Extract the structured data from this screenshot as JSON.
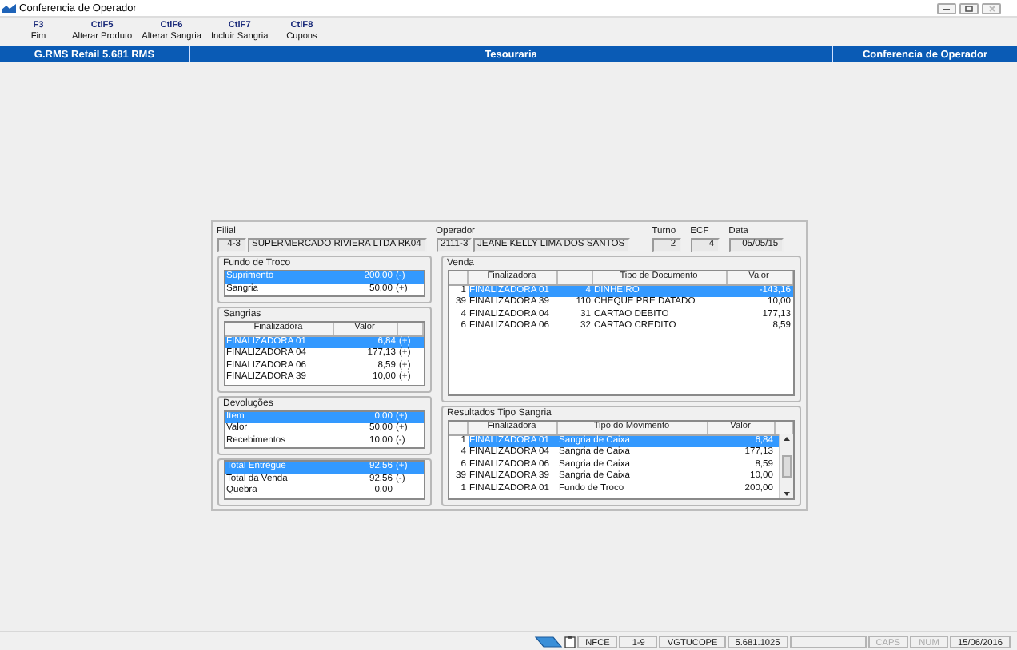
{
  "window": {
    "title": "Conferencia de Operador"
  },
  "toolbar": [
    {
      "key": "F3",
      "label": "Fim"
    },
    {
      "key": "CtlF5",
      "label": "Alterar Produto"
    },
    {
      "key": "CtlF6",
      "label": "Alterar Sangria"
    },
    {
      "key": "CtlF7",
      "label": "Incluir Sangria"
    },
    {
      "key": "CtlF8",
      "label": "Cupons"
    }
  ],
  "header": {
    "system": "G.RMS Retail 5.681 RMS",
    "section": "Tesouraria",
    "screen": "Conferencia de Operador"
  },
  "info": {
    "filial": {
      "label": "Filial",
      "code": "4-3",
      "name": "SUPERMERCADO RIVIERA LTDA RK04"
    },
    "operador": {
      "label": "Operador",
      "code": "2111-3",
      "name": "JEANE KELLY LIMA DOS SANTOS"
    },
    "turno": {
      "label": "Turno",
      "value": "2"
    },
    "ecf": {
      "label": "ECF",
      "value": "4"
    },
    "data": {
      "label": "Data",
      "value": "05/05/15"
    }
  },
  "fundo_de_troco": {
    "title": "Fundo de Troco",
    "rows": [
      {
        "label": "Suprimento",
        "value": "200,00",
        "sign": "(-)",
        "selected": true
      },
      {
        "label": "Sangria",
        "value": "50,00",
        "sign": "(+)",
        "selected": false
      }
    ]
  },
  "sangrias": {
    "title": "Sangrias",
    "columns": [
      "Finalizadora",
      "Valor"
    ],
    "rows": [
      {
        "finalizadora": "FINALIZADORA 01",
        "valor": "6,84",
        "sign": "(+)",
        "selected": true
      },
      {
        "finalizadora": "FINALIZADORA 04",
        "valor": "177,13",
        "sign": "(+)",
        "selected": false
      },
      {
        "finalizadora": "FINALIZADORA 06",
        "valor": "8,59",
        "sign": "(+)",
        "selected": false
      },
      {
        "finalizadora": "FINALIZADORA 39",
        "valor": "10,00",
        "sign": "(+)",
        "selected": false
      }
    ]
  },
  "devolucoes": {
    "title": "Devoluções",
    "rows": [
      {
        "label": "Item",
        "value": "0,00",
        "sign": "(+)",
        "selected": true
      },
      {
        "label": "Valor",
        "value": "50,00",
        "sign": "(+)",
        "selected": false
      },
      {
        "label": "Recebimentos",
        "value": "10,00",
        "sign": "(-)",
        "selected": false
      }
    ]
  },
  "totais": {
    "rows": [
      {
        "label": "Total Entregue",
        "value": "92,56",
        "sign": "(+)",
        "selected": true
      },
      {
        "label": "Total da Venda",
        "value": "92,56",
        "sign": "(-)",
        "selected": false
      },
      {
        "label": "Quebra",
        "value": "0,00",
        "selected": false
      }
    ]
  },
  "venda": {
    "title": "Venda",
    "columns": [
      "Finalizadora",
      "Tipo de Documento",
      "Valor"
    ],
    "rows": [
      {
        "num": "1",
        "finalizadora": "FINALIZADORA 01",
        "code": "4",
        "tipo": "DINHEIRO",
        "valor": "-143,16",
        "selected": true
      },
      {
        "num": "39",
        "finalizadora": "FINALIZADORA 39",
        "code": "110",
        "tipo": "CHEQUE PRE DATADO",
        "valor": "10,00",
        "selected": false
      },
      {
        "num": "4",
        "finalizadora": "FINALIZADORA 04",
        "code": "31",
        "tipo": "CARTAO DEBITO",
        "valor": "177,13",
        "selected": false
      },
      {
        "num": "6",
        "finalizadora": "FINALIZADORA 06",
        "code": "32",
        "tipo": "CARTAO CREDITO",
        "valor": "8,59",
        "selected": false
      }
    ]
  },
  "resultados": {
    "title": "Resultados Tipo Sangria",
    "columns": [
      "Finalizadora",
      "Tipo do Movimento",
      "Valor"
    ],
    "rows": [
      {
        "num": "1",
        "finalizadora": "FINALIZADORA 01",
        "tipo": "Sangria de Caixa",
        "valor": "6,84",
        "selected": true
      },
      {
        "num": "4",
        "finalizadora": "FINALIZADORA 04",
        "tipo": "Sangria de Caixa",
        "valor": "177,13",
        "selected": false
      },
      {
        "num": "6",
        "finalizadora": "FINALIZADORA 06",
        "tipo": "Sangria de Caixa",
        "valor": "8,59",
        "selected": false
      },
      {
        "num": "39",
        "finalizadora": "FINALIZADORA 39",
        "tipo": "Sangria de Caixa",
        "valor": "10,00",
        "selected": false
      },
      {
        "num": "1",
        "finalizadora": "FINALIZADORA 01",
        "tipo": "Fundo de Troco",
        "valor": "200,00",
        "selected": false
      }
    ]
  },
  "status_bar": [
    {
      "text": "NFCE",
      "disabled": false
    },
    {
      "text": "1-9",
      "disabled": false
    },
    {
      "text": "VGTUCOPE",
      "disabled": false
    },
    {
      "text": "5.681.1025",
      "disabled": false
    },
    {
      "text": "CAPS",
      "disabled": true
    },
    {
      "text": "NUM",
      "disabled": true
    },
    {
      "text": "15/06/2016",
      "disabled": false
    }
  ]
}
